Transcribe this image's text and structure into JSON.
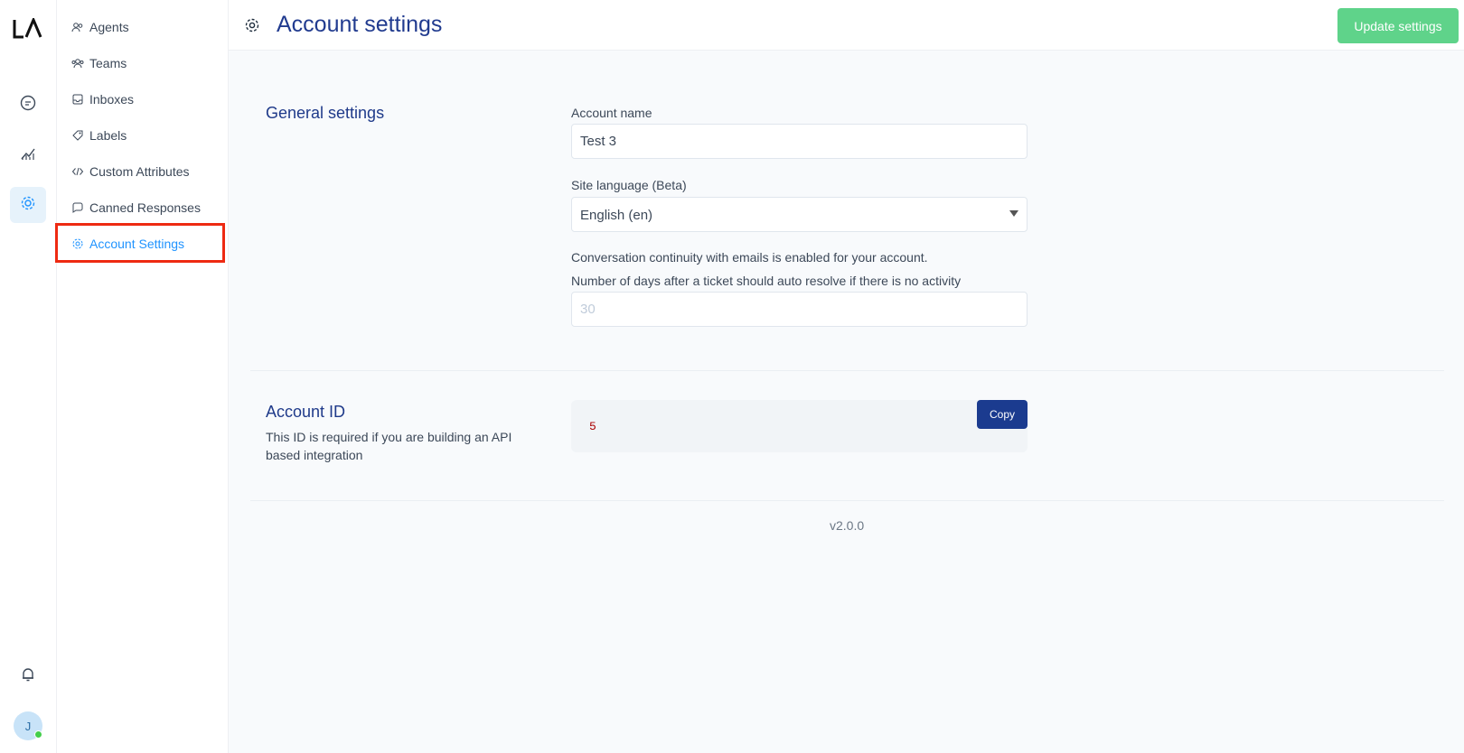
{
  "rail": {
    "logo_text": "LA",
    "items": [
      "conversations",
      "reports",
      "settings"
    ],
    "notifications": "bell",
    "avatar_initial": "J"
  },
  "subnav": {
    "items": [
      {
        "label": "Agents",
        "icon": "agents-icon"
      },
      {
        "label": "Teams",
        "icon": "teams-icon"
      },
      {
        "label": "Inboxes",
        "icon": "inbox-icon"
      },
      {
        "label": "Labels",
        "icon": "tag-icon"
      },
      {
        "label": "Custom Attributes",
        "icon": "code-icon"
      },
      {
        "label": "Canned Responses",
        "icon": "chat-icon"
      },
      {
        "label": "Account Settings",
        "icon": "gear-icon"
      }
    ],
    "active_index": 6
  },
  "header": {
    "title": "Account settings",
    "update_button": "Update settings"
  },
  "general": {
    "section_title": "General settings",
    "account_name_label": "Account name",
    "account_name_value": "Test 3",
    "language_label": "Site language (Beta)",
    "language_value": "English (en)",
    "continuity_note": "Conversation continuity with emails is enabled for your account.",
    "auto_resolve_label": "Number of days after a ticket should auto resolve if there is no activity",
    "auto_resolve_placeholder": "30"
  },
  "account_id": {
    "section_title": "Account ID",
    "description": "This ID is required if you are building an API based integration",
    "value": "5",
    "copy_label": "Copy"
  },
  "version": "v2.0.0",
  "colors": {
    "accent": "#1f93ff",
    "primary_dark": "#1b3b8f",
    "success": "#5fd38a",
    "highlight": "#ee2a12"
  }
}
